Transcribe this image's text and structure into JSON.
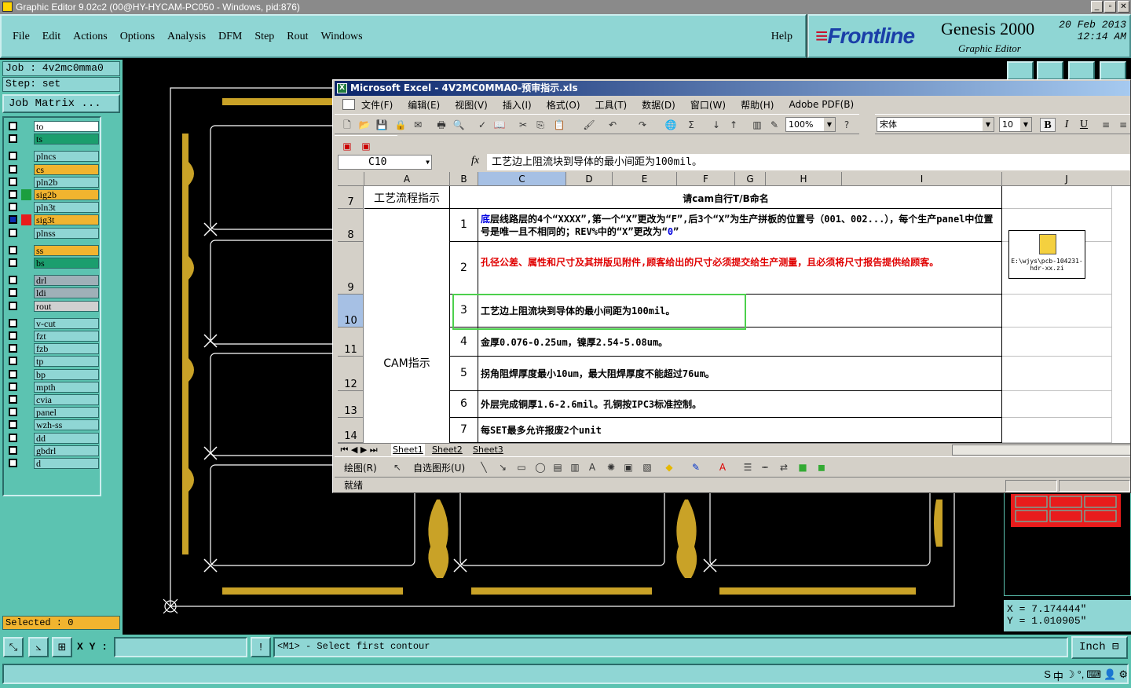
{
  "genesis": {
    "title": "Graphic Editor 9.02c2 (00@HY-HYCAM-PC050 - Windows, pid:876)",
    "menu": [
      "File",
      "Edit",
      "Actions",
      "Options",
      "Analysis",
      "DFM",
      "Step",
      "Rout",
      "Windows"
    ],
    "help": "Help",
    "brand_logo": "Frontline",
    "product": "Genesis 2000",
    "subtitle": "Graphic Editor",
    "date": "20 Feb 2013",
    "time": "12:14 AM",
    "job": "Job : 4v2mc0mma0",
    "step": "Step: set",
    "job_matrix": "Job Matrix ...",
    "layers": [
      {
        "name": "to",
        "color": "#ffffff",
        "swatch": "#5cc3b1"
      },
      {
        "name": "ts",
        "color": "#1b9e6e",
        "swatch": "#5cc3b1"
      },
      {
        "name": "plncs",
        "color": "#8fd6d4",
        "swatch": "#5cc3b1"
      },
      {
        "name": "cs",
        "color": "#f1b42f",
        "swatch": "#5cc3b1"
      },
      {
        "name": "pln2b",
        "color": "#8fd6d4",
        "swatch": "#5cc3b1"
      },
      {
        "name": "sig2b",
        "color": "#f1b42f",
        "swatch": "#1b9e3e"
      },
      {
        "name": "pln3t",
        "color": "#8fd6d4",
        "swatch": "#5cc3b1"
      },
      {
        "name": "sig3t",
        "color": "#f1b42f",
        "swatch": "#e81c1c",
        "selected": true
      },
      {
        "name": "plnss",
        "color": "#8fd6d4",
        "swatch": "#5cc3b1"
      },
      {
        "name": "ss",
        "color": "#f1b42f",
        "swatch": "#5cc3b1"
      },
      {
        "name": "bs",
        "color": "#1b9e6e",
        "swatch": "#5cc3b1"
      },
      {
        "name": "drl",
        "color": "#9fb0b8",
        "swatch": "#5cc3b1"
      },
      {
        "name": "ldi",
        "color": "#9fb0b8",
        "swatch": "#5cc3b1"
      },
      {
        "name": "rout",
        "color": "#d0d0d0",
        "swatch": "#5cc3b1"
      },
      {
        "name": "v-cut",
        "color": "#8fd6d4",
        "swatch": "#5cc3b1"
      },
      {
        "name": "fzt",
        "color": "#8fd6d4",
        "swatch": "#5cc3b1"
      },
      {
        "name": "fzb",
        "color": "#8fd6d4",
        "swatch": "#5cc3b1"
      },
      {
        "name": "tp",
        "color": "#8fd6d4",
        "swatch": "#5cc3b1"
      },
      {
        "name": "bp",
        "color": "#8fd6d4",
        "swatch": "#5cc3b1"
      },
      {
        "name": "mpth",
        "color": "#8fd6d4",
        "swatch": "#5cc3b1"
      },
      {
        "name": "cvia",
        "color": "#8fd6d4",
        "swatch": "#5cc3b1"
      },
      {
        "name": "panel",
        "color": "#8fd6d4",
        "swatch": "#5cc3b1"
      },
      {
        "name": "wzh-ss",
        "color": "#8fd6d4",
        "swatch": "#5cc3b1"
      },
      {
        "name": "dd",
        "color": "#8fd6d4",
        "swatch": "#5cc3b1"
      },
      {
        "name": "gbdrl",
        "color": "#8fd6d4",
        "swatch": "#5cc3b1"
      },
      {
        "name": "d",
        "color": "#8fd6d4",
        "swatch": "#5cc3b1"
      }
    ],
    "selected": "Selected : 0",
    "coord_x": "X = 7.174444\"",
    "coord_y": "Y = 1.010905\"",
    "xy_label": "X Y :",
    "xy_value": "",
    "prompt": "<M1> - Select first contour",
    "units": "Inch",
    "colors": {
      "panel": "#5cc3b1",
      "field": "#8fd6d4",
      "copper": "#c9a227",
      "profile": "#ffffff"
    }
  },
  "excel": {
    "title": "Microsoft Excel - 4V2MC0MMA0-预审指示.xls",
    "menu": [
      "文件(F)",
      "编辑(E)",
      "视图(V)",
      "插入(I)",
      "格式(O)",
      "工具(T)",
      "数据(D)",
      "窗口(W)",
      "帮助(H)",
      "Adobe PDF(B)"
    ],
    "zoom": "100%",
    "font": "宋体",
    "font_size": "10",
    "name_box": "C10",
    "formula": "工艺边上阻流块到导体的最小间距为100mil。",
    "columns": [
      "A",
      "B",
      "C",
      "D",
      "E",
      "F",
      "G",
      "H",
      "I",
      "J"
    ],
    "rows": [
      "7",
      "8",
      "9",
      "10",
      "11",
      "12",
      "13",
      "14"
    ],
    "header_a7": "工艺流程指示",
    "header_c7": "请cam自行T/B命名",
    "cam_label": "CAM指示",
    "items": [
      {
        "num": "1",
        "text_first": "底",
        "text": "层线路层的4个“XXXX”,第一个“X”更改为“F”,后3个“X”为生产拼板的位置号（001、002...），每个生产panel中位置号是唯一且不相同的；REV%中的“X”更改为“",
        "text_tail": "0",
        "text_end": "”"
      },
      {
        "num": "2",
        "text": "孔径公差、属性和尺寸及其拼版见附件,顾客给出的尺寸必须提交给生产测量，且必须将尺寸报告提供给顾客。"
      },
      {
        "num": "3",
        "text": "工艺边上阻流块到导体的最小间距为100mil。"
      },
      {
        "num": "4",
        "text": "金厚0.076-0.25um，镍厚2.54-5.08um。"
      },
      {
        "num": "5",
        "text": "拐角阻焊厚度最小10um，最大阻焊厚度不能超过76um。"
      },
      {
        "num": "6",
        "text": "外层完成铜厚1.6-2.6mil。孔铜按IPC3标准控制。"
      },
      {
        "num": "7",
        "text": "每SET最多允许报废2个unit"
      }
    ],
    "attachment": "E:\\wjys\\pcb-104231-hdr-xx.zi",
    "sheets": [
      "Sheet1",
      "Sheet2",
      "Sheet3"
    ],
    "draw_label": "绘图(R)",
    "autoshape_label": "自选图形(U)",
    "status": "就绪"
  },
  "taskbar_ime": [
    "S",
    "中",
    "☽",
    "°,",
    "⌨",
    "👤",
    "⚙"
  ]
}
